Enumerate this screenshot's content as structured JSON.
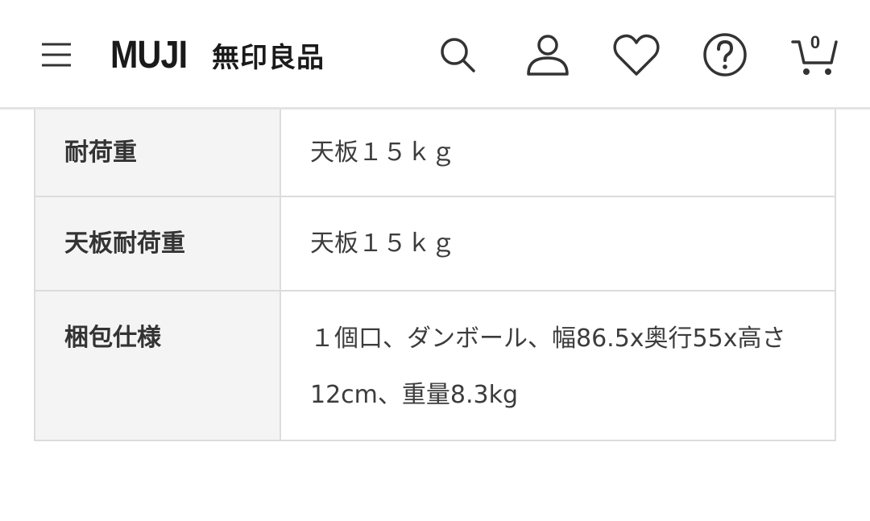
{
  "header": {
    "logo_text": "MUJI",
    "logo_sub": "無印良品",
    "cart_count": "0",
    "icons": [
      "menu-icon",
      "search-icon",
      "account-icon",
      "heart-icon",
      "help-icon",
      "cart-icon"
    ],
    "icon_color": "#333333",
    "border_color": "#e3e3e3"
  },
  "specs": [
    {
      "label": "耐荷重",
      "value": "天板１５ｋｇ"
    },
    {
      "label": "天板耐荷重",
      "value": "天板１５ｋｇ"
    },
    {
      "label": "梱包仕様",
      "value": "１個口、ダンボール、幅86.5x奥行55x高さ12cm、重量8.3kg"
    }
  ],
  "colors": {
    "label_bg": "#f4f4f4",
    "border": "#dcdcdc"
  }
}
